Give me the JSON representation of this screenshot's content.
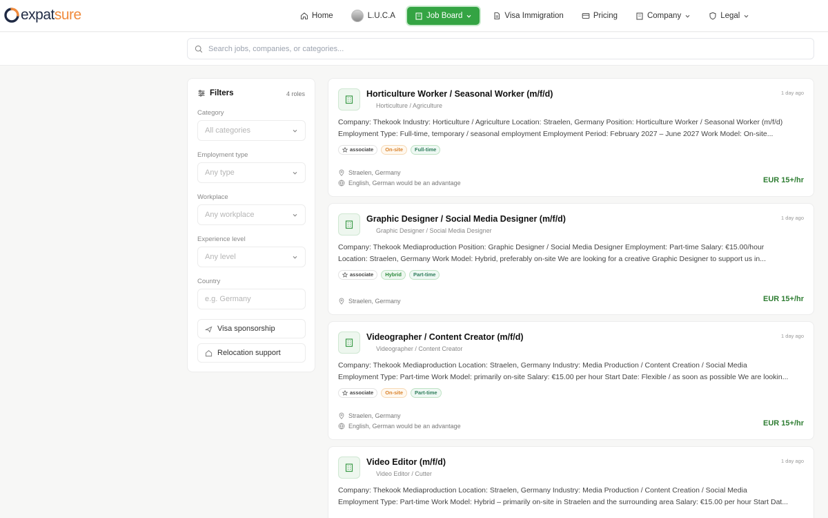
{
  "brand": {
    "part1": "expat",
    "part2": "sure",
    "accent": "#34a443",
    "orange": "#f08a3c"
  },
  "nav": {
    "home": "Home",
    "luca": "L.U.C.A",
    "job_board": "Job Board",
    "visa": "Visa Immigration",
    "pricing": "Pricing",
    "company": "Company",
    "legal": "Legal"
  },
  "search": {
    "placeholder": "Search jobs, companies, or categories..."
  },
  "filters": {
    "title": "Filters",
    "count": "4 roles",
    "category_label": "Category",
    "category_value": "All categories",
    "employment_label": "Employment type",
    "employment_value": "Any type",
    "workplace_label": "Workplace",
    "workplace_value": "Any workplace",
    "experience_label": "Experience level",
    "experience_value": "Any level",
    "country_label": "Country",
    "country_placeholder": "e.g. Germany",
    "visa_btn": "Visa sponsorship",
    "relocation_btn": "Relocation support"
  },
  "jobs": [
    {
      "title": "Horticulture Worker / Seasonal Worker (m/f/d)",
      "category": "Horticulture / Agriculture",
      "posted": "1 day ago",
      "desc1": "Company: Thekook Industry: Horticulture / Agriculture Location: Straelen, Germany Position: Horticulture Worker / Seasonal Worker (m/f/d)",
      "desc2": "Employment Type: Full-time, temporary / seasonal employment Employment Period: February 2027 – June 2027 Work Model: On-site...",
      "tag_level": "associate",
      "tag_workplace": "On-site",
      "tag_type": "Full-time",
      "location": "Straelen, Germany",
      "language": "English, German would be an advantage",
      "salary": "EUR 15+/hr"
    },
    {
      "title": "Graphic Designer / Social Media Designer (m/f/d)",
      "category": "Graphic Designer / Social Media Designer",
      "posted": "1 day ago",
      "desc1": "Company: Thekook Mediaproduction Position: Graphic Designer / Social Media Designer Employment: Part-time Salary: €15.00/hour",
      "desc2": "Location: Straelen, Germany Work Model: Hybrid, preferably on-site We are looking for a creative Graphic Designer to support us in...",
      "tag_level": "associate",
      "tag_workplace": "Hybrid",
      "tag_type": "Part-time",
      "location": "Straelen, Germany",
      "salary": "EUR 15+/hr"
    },
    {
      "title": "Videographer / Content Creator (m/f/d)",
      "category": "Videographer / Content Creator",
      "posted": "1 day ago",
      "desc1": "Company: Thekook Mediaproduction Location: Straelen, Germany Industry: Media Production / Content Creation / Social Media",
      "desc2": "Employment Type: Part-time Work Model: primarily on-site Salary: €15.00 per hour Start Date: Flexible / as soon as possible We are lookin...",
      "tag_level": "associate",
      "tag_workplace": "On-site",
      "tag_type": "Part-time",
      "location": "Straelen, Germany",
      "language": "English, German would be an advantage",
      "salary": "EUR 15+/hr"
    },
    {
      "title": "Video Editor (m/f/d)",
      "category": "Video Editor / Cutter",
      "posted": "1 day ago",
      "desc1": "Company: Thekook Mediaproduction Location: Straelen, Germany Industry: Media Production / Content Creation / Social Media",
      "desc2": "Employment Type: Part-time Work Model: Hybrid – primarily on-site in Straelen and the surrounding area Salary: €15.00 per hour Start Dat..."
    }
  ]
}
